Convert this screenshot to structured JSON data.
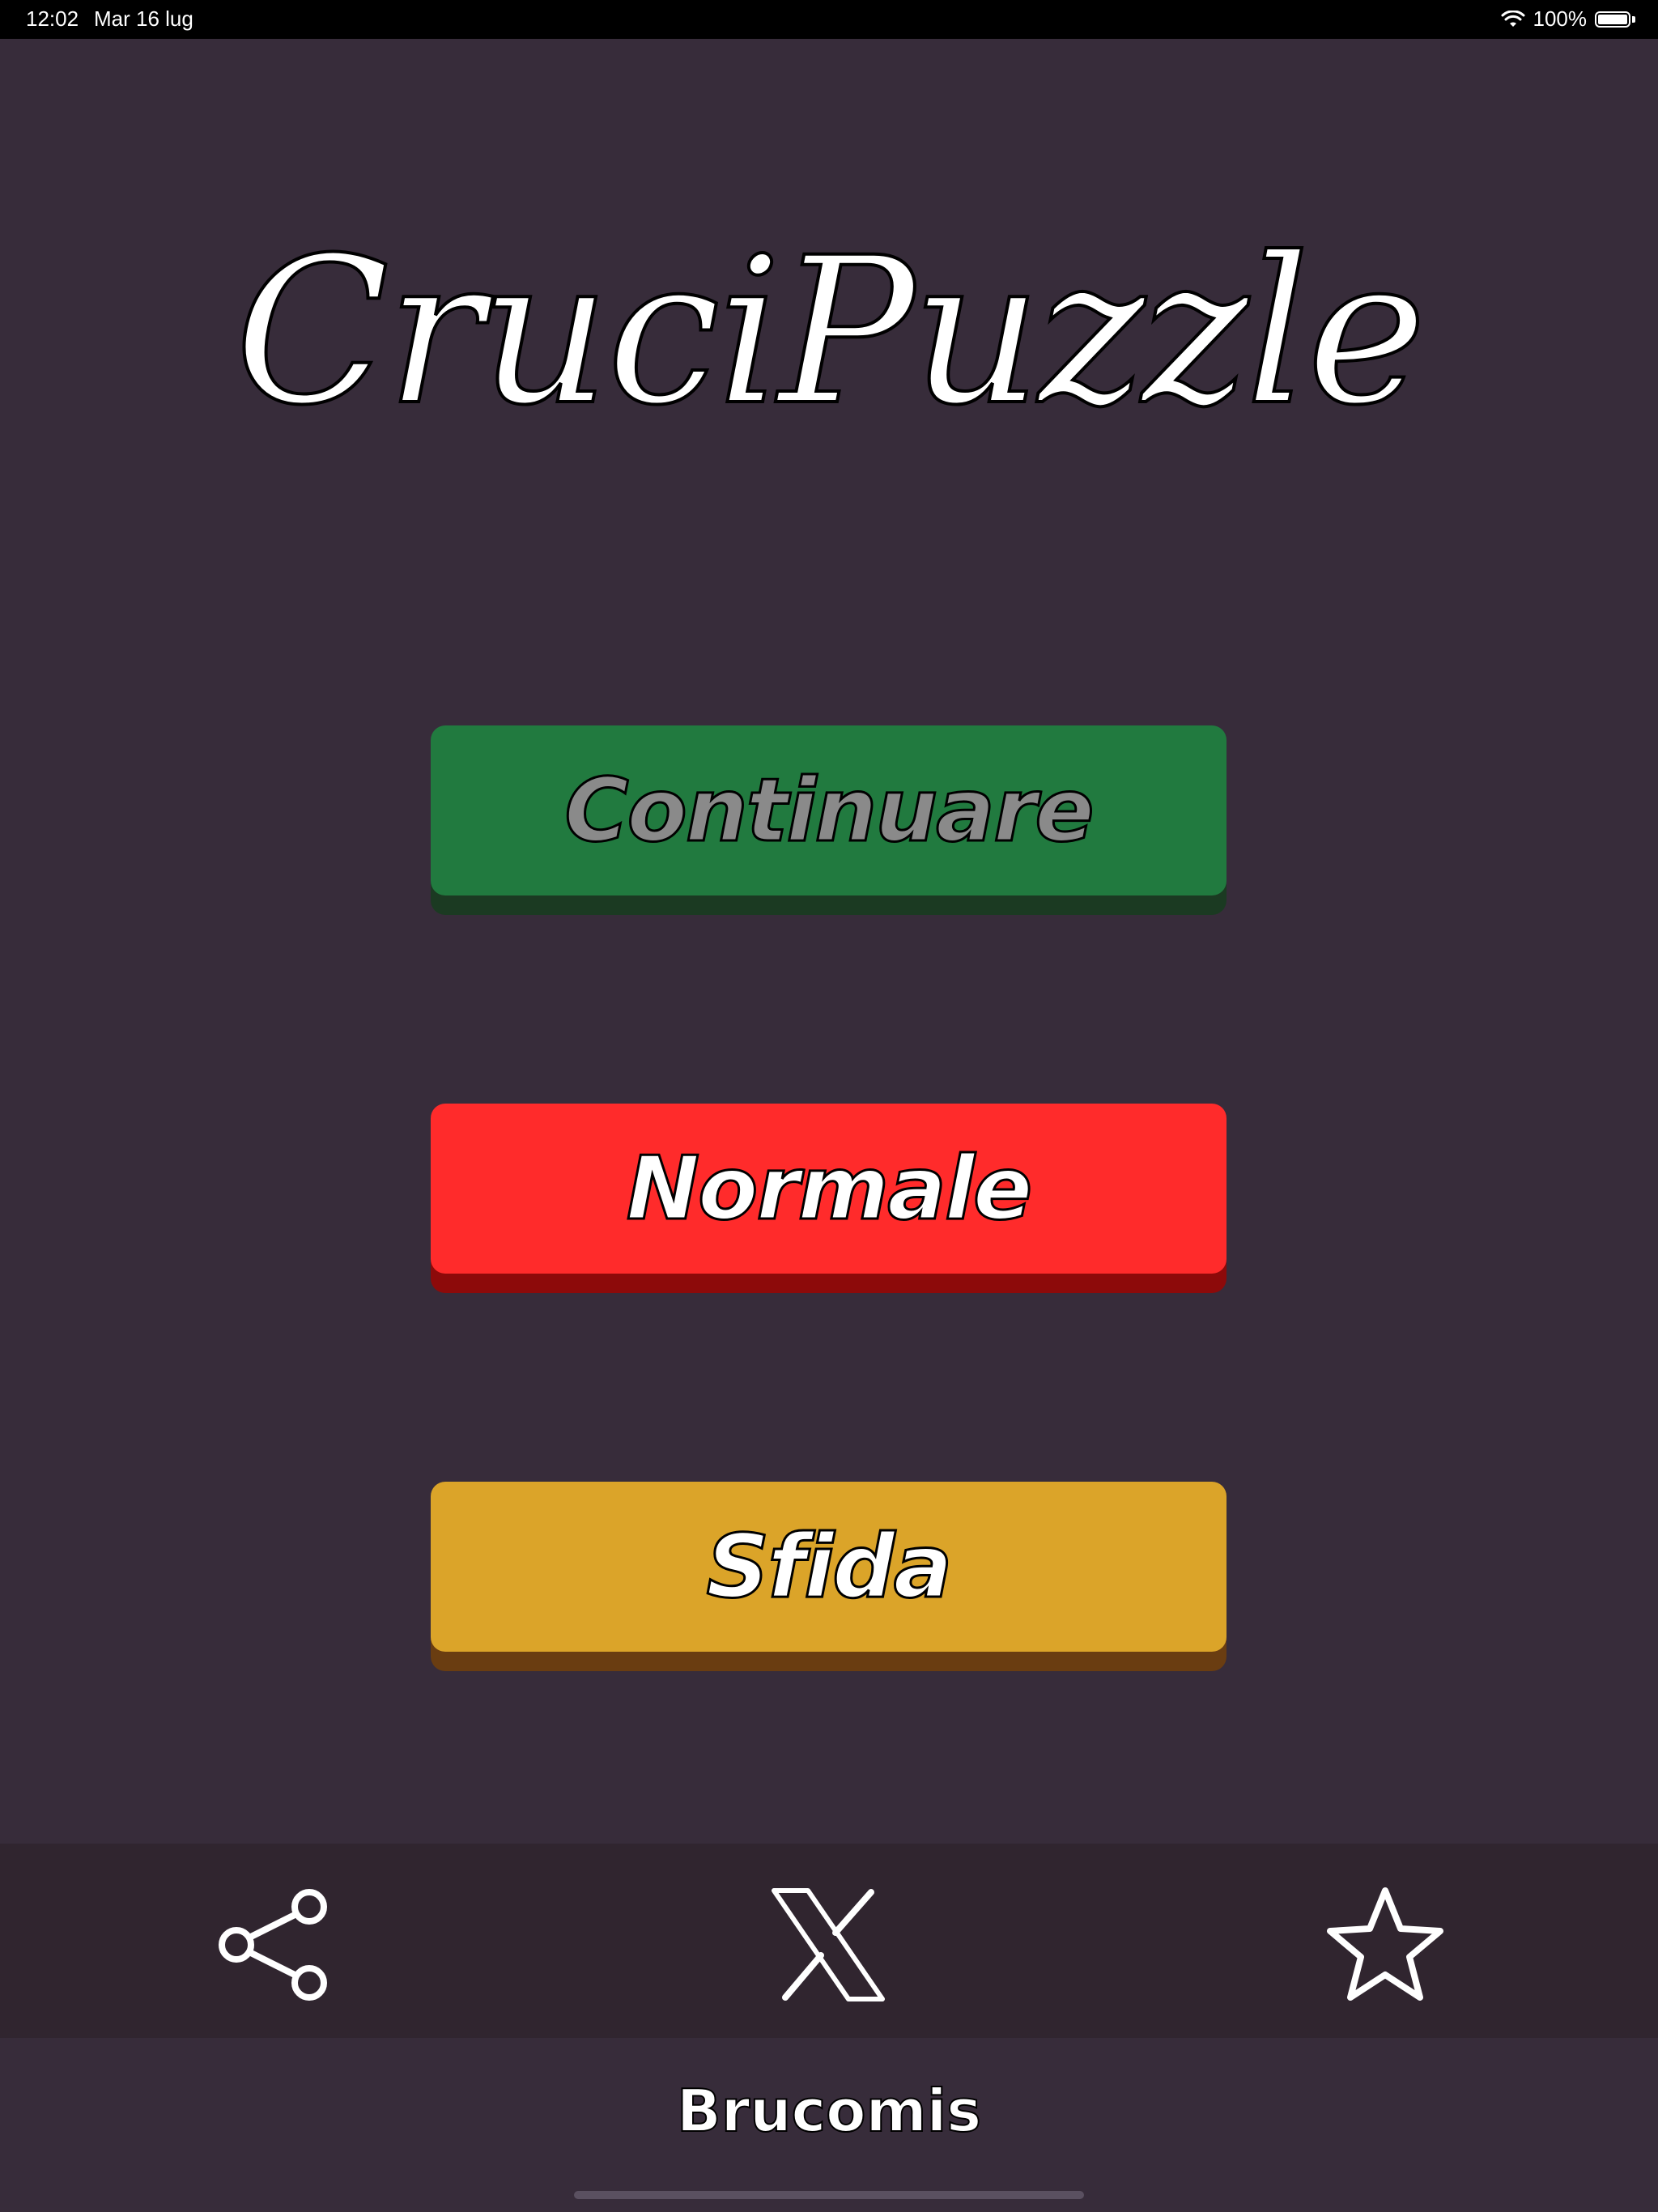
{
  "status_bar": {
    "time": "12:02",
    "date": "Mar 16 lug",
    "battery": "100%",
    "wifi_icon": "wifi-icon",
    "battery_icon": "battery-icon"
  },
  "app": {
    "title": "CruciPuzzle"
  },
  "menu": {
    "continue_label": "Continuare",
    "normal_label": "Normale",
    "challenge_label": "Sfida"
  },
  "toolbar": {
    "share_icon": "share-icon",
    "x_icon": "x-logo-icon",
    "star_icon": "star-icon"
  },
  "footer": {
    "brand": "Brucomis"
  },
  "colors": {
    "background": "#372c3a",
    "continue": "#217a3f",
    "normal": "#ff2b2b",
    "challenge": "#dba429",
    "toolbar": "#30252f"
  }
}
